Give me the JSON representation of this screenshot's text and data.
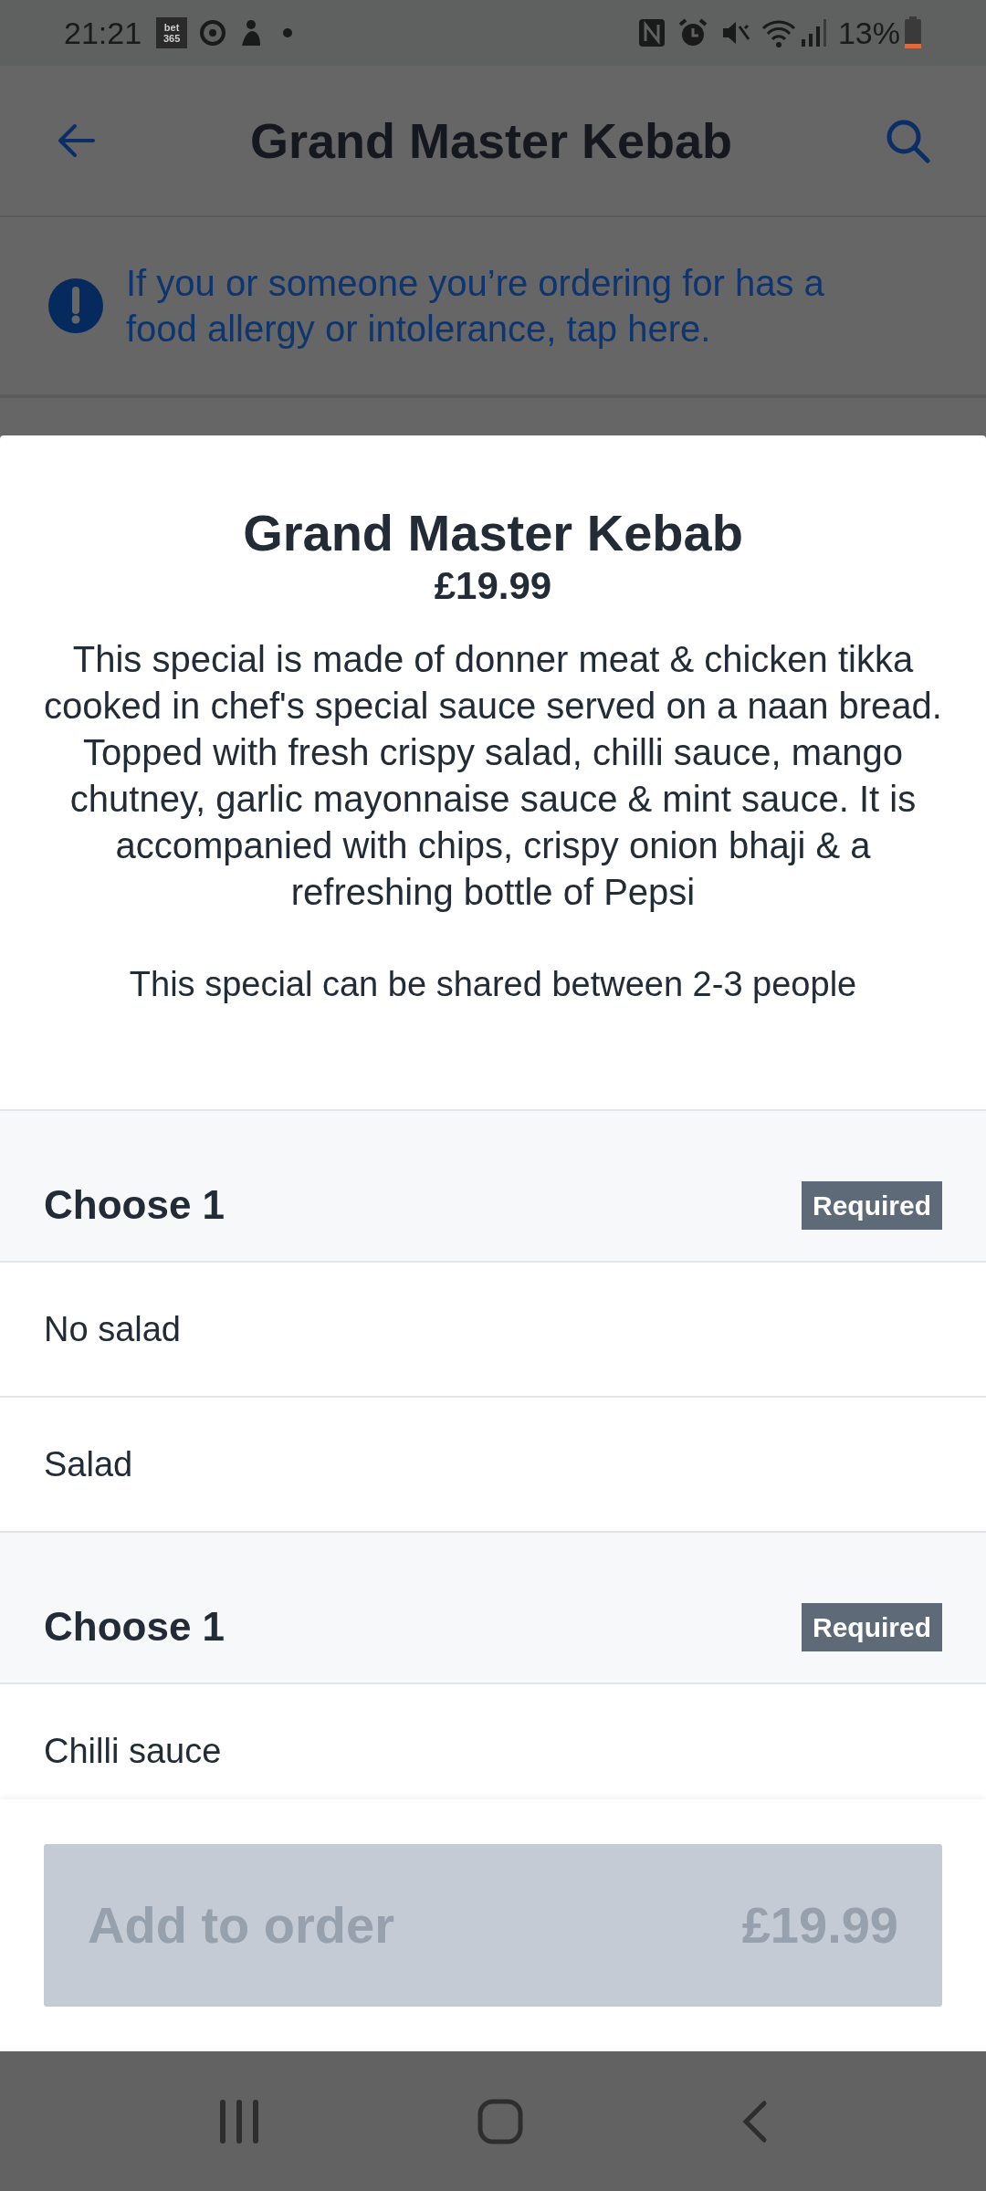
{
  "status_bar": {
    "time": "21:21",
    "app_badge": "bet\n365",
    "battery": "13%"
  },
  "header": {
    "title": "Grand Master Kebab"
  },
  "allergy_banner": {
    "text": "If you or someone you’re ordering for has a food allergy or intolerance, tap here."
  },
  "item": {
    "title": "Grand Master Kebab",
    "price": "£19.99",
    "description": "This special is made of donner meat & chicken tikka cooked in chef's special sauce served on a naan bread. Topped with fresh crispy salad, chilli sauce, mango chutney, garlic mayonnaise sauce & mint sauce. It is accompanied with chips, crispy onion bhaji & a refreshing bottle of Pepsi",
    "note": "This special can be shared between 2-3 people"
  },
  "option_groups": [
    {
      "title": "Choose 1",
      "badge": "Required",
      "options": [
        {
          "label": "No salad"
        },
        {
          "label": "Salad"
        }
      ]
    },
    {
      "title": "Choose 1",
      "badge": "Required",
      "options": [
        {
          "label": "Chilli sauce"
        }
      ]
    }
  ],
  "add_button": {
    "label": "Add to order",
    "price": "£19.99",
    "disabled": true
  }
}
